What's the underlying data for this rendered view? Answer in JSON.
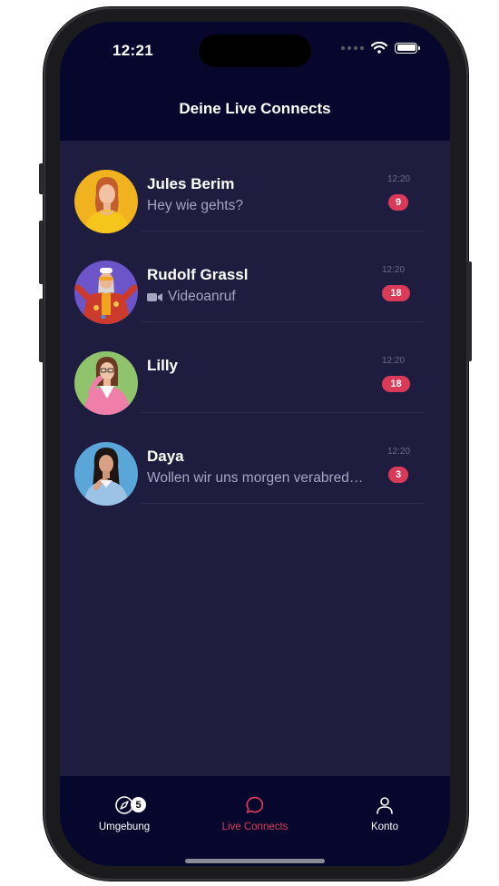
{
  "status_bar": {
    "time": "12:21"
  },
  "header": {
    "title": "Deine Live Connects"
  },
  "chats": [
    {
      "name": "Jules Berim",
      "preview": "Hey wie gehts?",
      "preview_icon": "",
      "time": "12:20",
      "unread": "9"
    },
    {
      "name": "Rudolf Grassl",
      "preview": "Videoanruf",
      "preview_icon": "video-camera-icon",
      "time": "12:20",
      "unread": "18"
    },
    {
      "name": "Lilly",
      "preview": "",
      "preview_icon": "",
      "time": "12:20",
      "unread": "18"
    },
    {
      "name": "Daya",
      "preview": "Wollen wir uns morgen verabred…",
      "preview_icon": "",
      "time": "12:20",
      "unread": "3"
    }
  ],
  "tabbar": {
    "tabs": [
      {
        "label": "Umgebung",
        "icon": "compass-icon",
        "badge": "5",
        "active": false
      },
      {
        "label": "Live Connects",
        "icon": "chat-bubble-icon",
        "badge": "",
        "active": true
      },
      {
        "label": "Konto",
        "icon": "person-icon",
        "badge": "",
        "active": false
      }
    ]
  },
  "colors": {
    "background": "#07062c",
    "list_background": "#1e1d40",
    "badge": "#d93a58",
    "active_tab": "#d93a58",
    "inactive_tab": "#ffffff"
  }
}
